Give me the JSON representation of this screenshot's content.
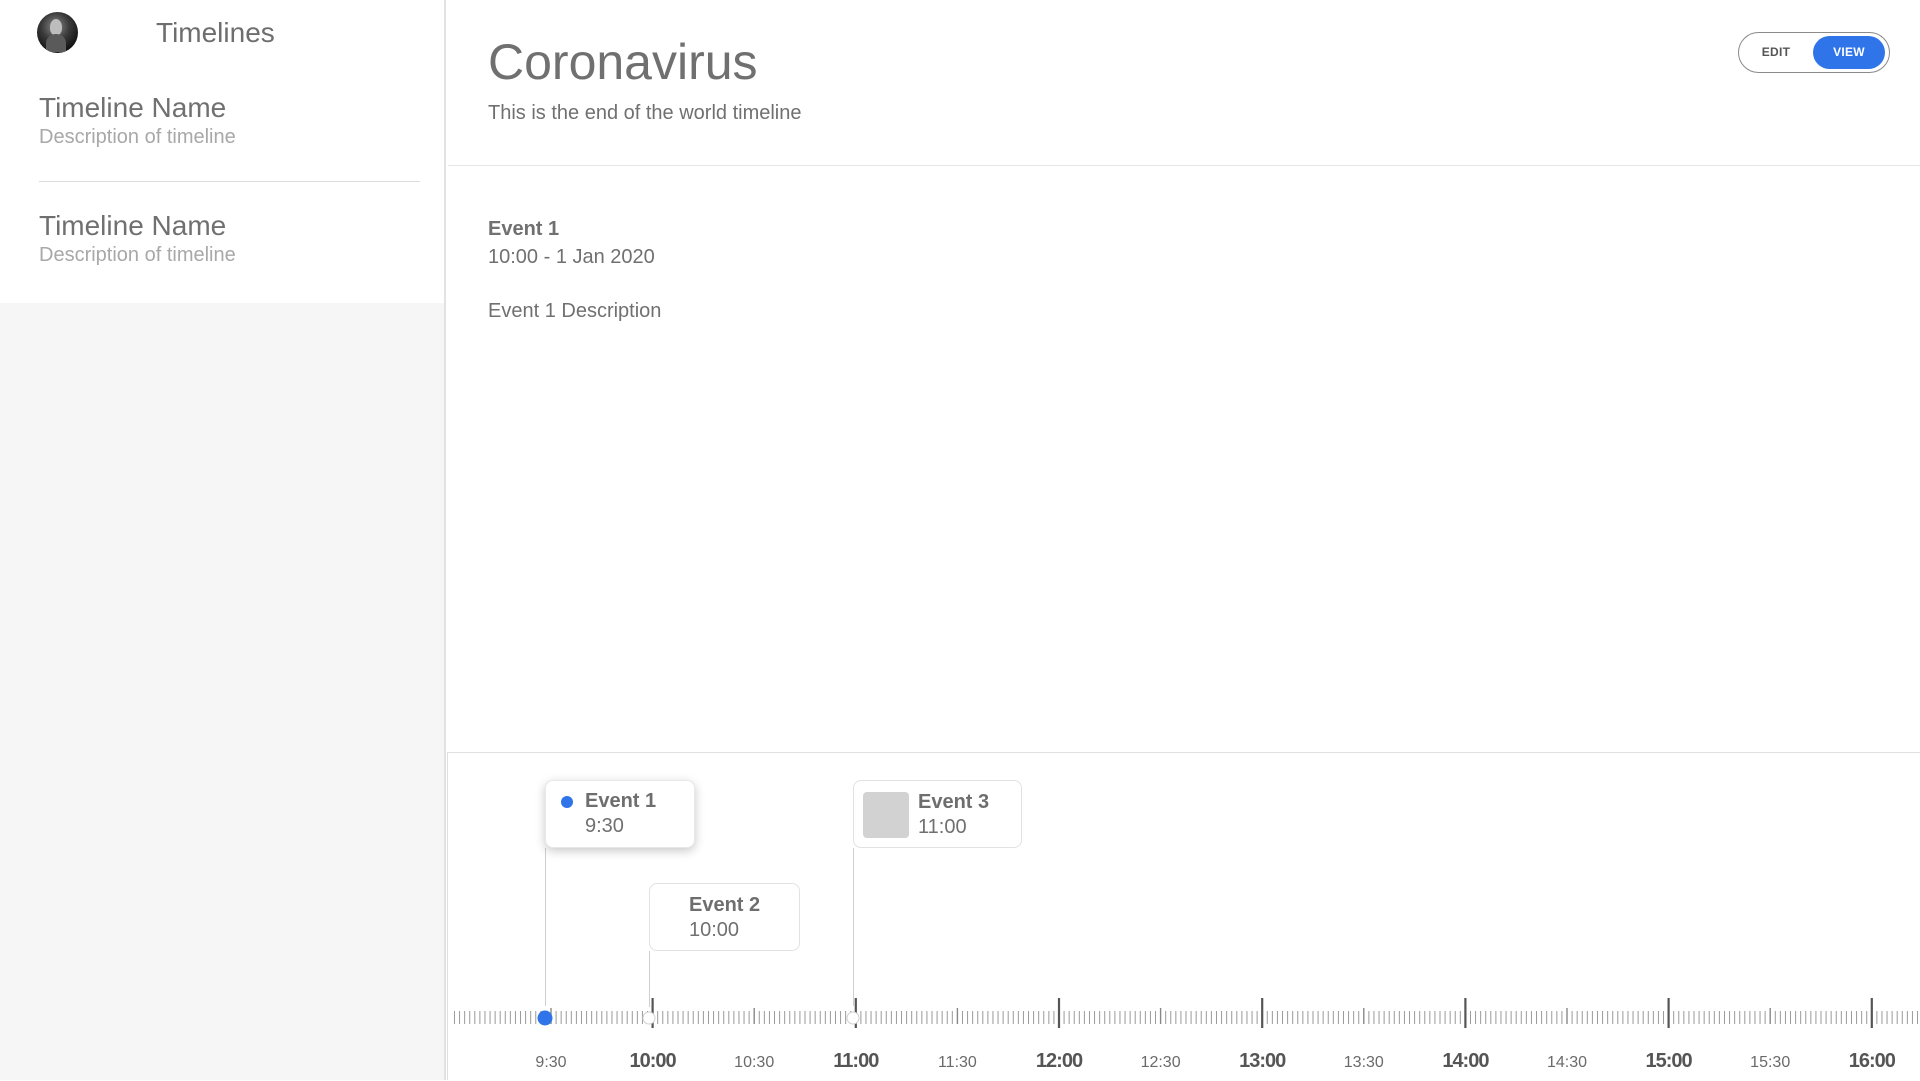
{
  "sidebar": {
    "app_title": "Timelines",
    "timelines": [
      {
        "name": "Timeline Name",
        "description": "Description of timeline"
      },
      {
        "name": "Timeline Name",
        "description": "Description of timeline"
      }
    ]
  },
  "header": {
    "title": "Coronavirus",
    "subtitle": "This is the end of the world timeline",
    "mode_toggle": {
      "edit_label": "EDIT",
      "view_label": "VIEW",
      "selected": "VIEW"
    }
  },
  "selected_event": {
    "title": "Event 1",
    "datetime": "10:00 - 1 Jan 2020",
    "description": "Event 1 Description"
  },
  "timeline": {
    "events": [
      {
        "title": "Event 1",
        "time": "9:30",
        "active": true
      },
      {
        "title": "Event 2",
        "time": "10:00",
        "active": false
      },
      {
        "title": "Event 3",
        "time": "11:00",
        "active": false,
        "has_thumbnail": true
      }
    ],
    "axis_labels": [
      "9:30",
      "10:00",
      "10:30",
      "11:00",
      "11:30",
      "12:00",
      "12:30",
      "13:00",
      "13:30",
      "14:00",
      "14:30",
      "15:00",
      "15:30",
      "16:00"
    ],
    "accent_color": "#2f74e8"
  }
}
